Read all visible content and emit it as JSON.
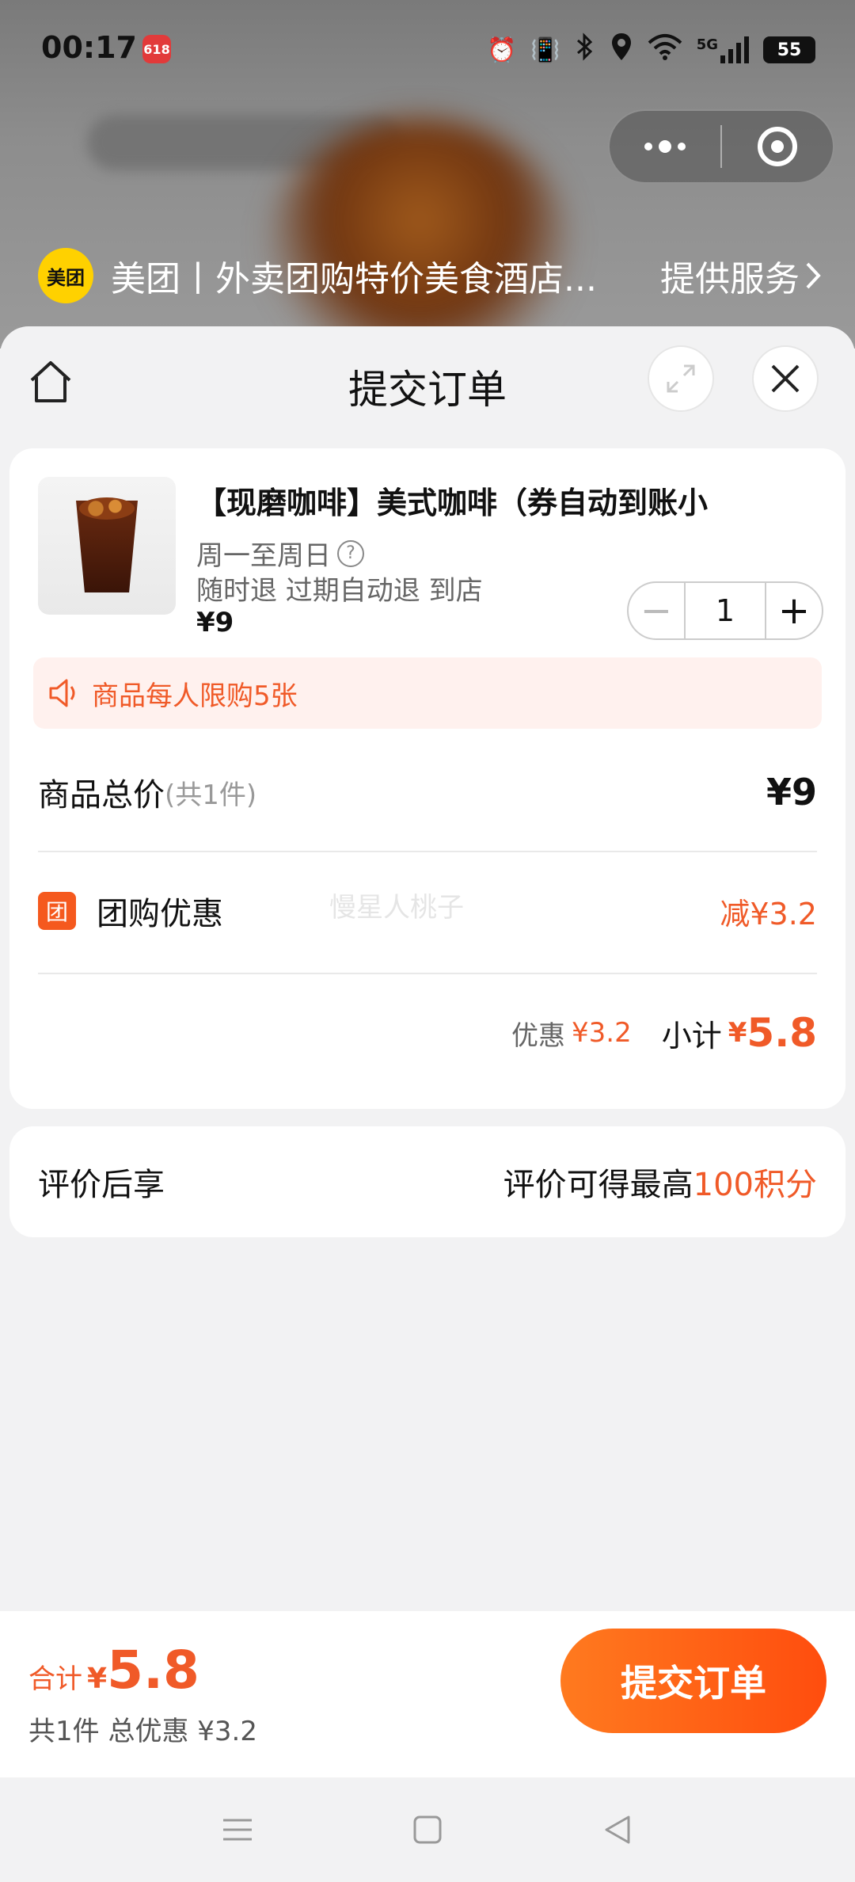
{
  "status_bar": {
    "time": "00:17",
    "app_badge": "618",
    "network": "5G",
    "battery": "55"
  },
  "provider": {
    "logo_text": "美团",
    "name": "美团丨外卖团购特价美食酒店...",
    "service_label": "提供服务"
  },
  "sheet": {
    "title": "提交订单"
  },
  "product": {
    "title": "【现磨咖啡】美式咖啡（券自动到账小",
    "days": "周一至周日",
    "refund": "随时退 过期自动退 到店",
    "price": "¥9",
    "quantity": "1"
  },
  "limit_banner": {
    "text": "商品每人限购5张"
  },
  "total": {
    "label": "商品总价",
    "count": "(共1件)",
    "value": "¥9"
  },
  "discount": {
    "icon_text": "团",
    "label": "团购优惠",
    "value": "减¥3.2"
  },
  "watermark": "慢星人桃子",
  "subtotal": {
    "discount_label": "优惠",
    "discount_value": "¥3.2",
    "label": "小计",
    "yen": "¥",
    "value": "5.8"
  },
  "review": {
    "label": "评价后享",
    "prefix": "评价可得最高",
    "highlight": "100积分"
  },
  "bottom": {
    "sum_label": "合计",
    "yen": "¥",
    "sum_value": "5.8",
    "sub": "共1件 总优惠 ¥3.2",
    "submit_label": "提交订单"
  },
  "colors": {
    "accent": "#f05a28",
    "meituan_yellow": "#ffd100"
  }
}
